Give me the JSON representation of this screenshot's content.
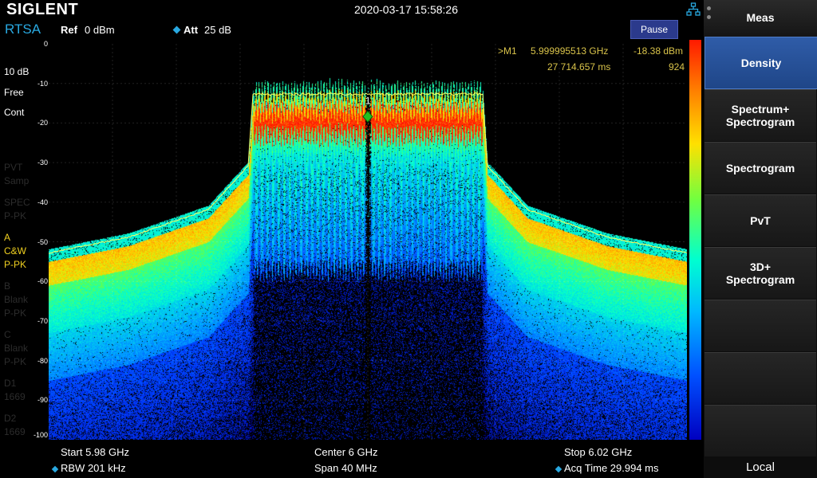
{
  "header": {
    "brand": "SIGLENT",
    "datetime": "2020-03-17 15:58:26",
    "network_icon": "network-icon"
  },
  "toolbar": {
    "mode": "RTSA",
    "ref_label": "Ref",
    "ref_value": "0 dBm",
    "att_label": "Att",
    "att_value": "25 dB",
    "pause_label": "Pause"
  },
  "left_panel": {
    "scale": "10 dB",
    "trigger": "Free",
    "sweep": "Cont",
    "trace_pvt": "PVT",
    "trace_pvt_detector": "Samp",
    "trace_spec": "SPEC",
    "trace_spec_detector": "P-PK",
    "trace_a": "A",
    "trace_a_mode": "C&W",
    "trace_a_detector": "P-PK",
    "trace_b": "B",
    "trace_b_mode": "Blank",
    "trace_b_detector": "P-PK",
    "trace_c": "C",
    "trace_c_mode": "Blank",
    "trace_c_detector": "P-PK",
    "trace_d1": "D1",
    "trace_d1_value": "1669",
    "trace_d2": "D2",
    "trace_d2_value": "1669"
  },
  "y_axis": {
    "ticks": [
      "0",
      "-10",
      "-20",
      "-30",
      "-40",
      "-50",
      "-60",
      "-70",
      "-80",
      "-90",
      "-100"
    ]
  },
  "marker": {
    "label": ">M1",
    "number": "1",
    "frequency": "5.999995513 GHz",
    "level": "-18.38 dBm",
    "time": "27 714.657 ms",
    "hits": "924"
  },
  "footer": {
    "start": "Start  5.98 GHz",
    "center": "Center  6 GHz",
    "stop": "Stop  6.02 GHz",
    "rbw": "RBW 201 kHz",
    "span": "Span  40 MHz",
    "acq_time": "Acq Time   29.994 ms"
  },
  "sidebar": {
    "title": "Meas",
    "items": [
      {
        "label": "Density",
        "active": true
      },
      {
        "label": "Spectrum+\nSpectrogram",
        "active": false
      },
      {
        "label": "Spectrogram",
        "active": false
      },
      {
        "label": "PvT",
        "active": false
      },
      {
        "label": "3D+\nSpectrogram",
        "active": false
      },
      {
        "label": "",
        "active": false
      },
      {
        "label": "",
        "active": false
      },
      {
        "label": "",
        "active": false
      }
    ],
    "status": "Local"
  },
  "chart_data": {
    "type": "heatmap",
    "description_kind": "persistence density spectrum",
    "x_range_ghz": [
      5.98,
      6.02
    ],
    "ylim": [
      -100,
      0
    ],
    "y_unit": "dBm",
    "grid": true,
    "colors": {
      "hot": "#ff1a00",
      "warm": "#ffe000",
      "mid": "#00ffd0",
      "cool": "#0050ff",
      "cold": "#0000c0",
      "trace": "#ffff60",
      "marker": "#20c020"
    },
    "envelope": {
      "x_ghz": [
        5.98,
        5.985,
        5.99,
        5.9925,
        5.9928,
        6.0,
        6.0072,
        6.0075,
        6.01,
        6.015,
        6.02
      ],
      "peak_dbm": [
        -53,
        -49,
        -42,
        -31,
        -13,
        -13,
        -13,
        -31,
        -42,
        -49,
        -53
      ]
    },
    "marker_point": {
      "x_ghz": 5.999995513,
      "y_dbm": -18.38
    }
  }
}
